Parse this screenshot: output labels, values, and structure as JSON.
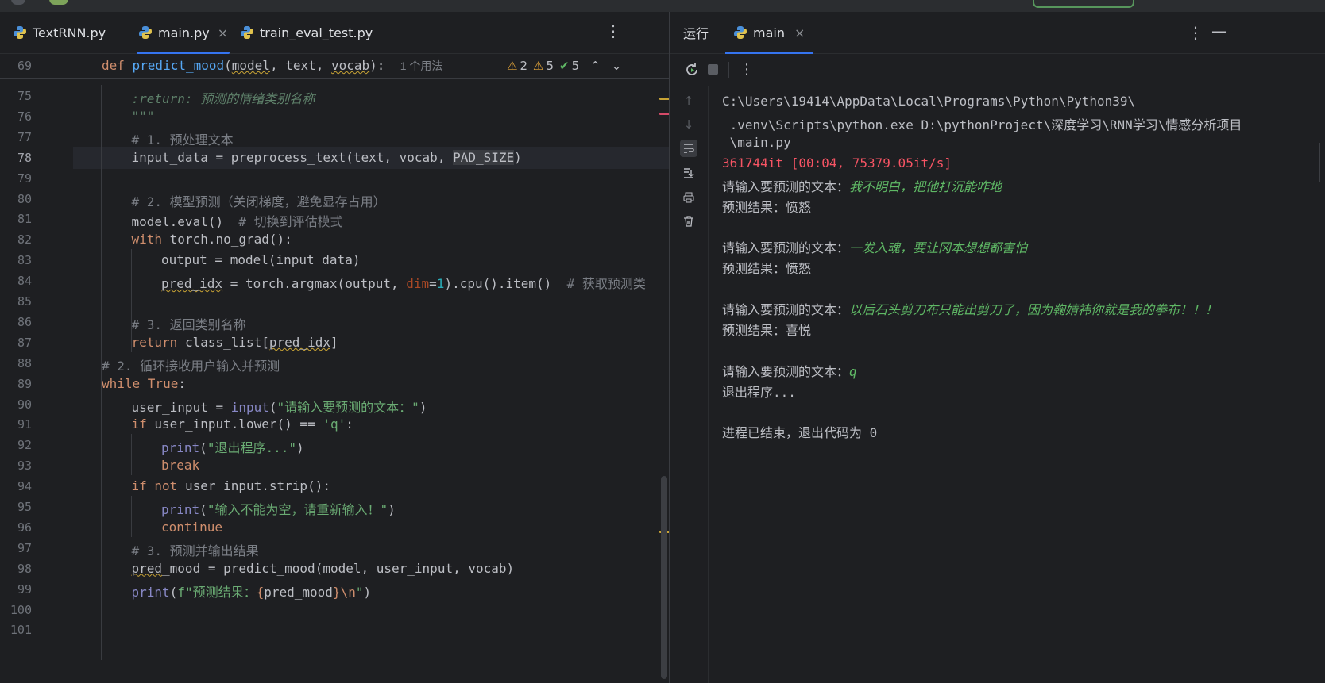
{
  "editor": {
    "tabs": [
      {
        "label": "TextRNN.py",
        "active": false,
        "closable": false
      },
      {
        "label": "main.py",
        "active": true,
        "closable": true
      },
      {
        "label": "train_eval_test.py",
        "active": false,
        "closable": false
      }
    ],
    "sticky": {
      "line_number": "69",
      "tokens": [
        {
          "t": "def ",
          "c": "k"
        },
        {
          "t": "predict_mood",
          "c": "fn"
        },
        {
          "t": "("
        },
        {
          "t": "model",
          "c": "ul"
        },
        {
          "t": ", text, "
        },
        {
          "t": "vocab",
          "c": "ul"
        },
        {
          "t": "):  "
        }
      ],
      "usage_hint": "1 个用法"
    },
    "inspections": {
      "errors": "2",
      "warnings": "5",
      "ok": "5"
    },
    "lines": [
      {
        "n": "75",
        "indent": 2,
        "tokens": [
          {
            "t": ":return:",
            "c": "doci"
          },
          {
            "t": " 预测的情绪类别名称",
            "c": "doci"
          }
        ]
      },
      {
        "n": "76",
        "indent": 2,
        "tokens": [
          {
            "t": "\"\"\"",
            "c": "doc"
          }
        ]
      },
      {
        "n": "77",
        "indent": 2,
        "tokens": [
          {
            "t": "# 1. 预处理文本",
            "c": "cm"
          }
        ]
      },
      {
        "n": "78",
        "indent": 2,
        "current": true,
        "tokens": [
          {
            "t": "input_data = preprocess_text(text, vocab, "
          },
          {
            "t": "PAD_SIZE",
            "c": "pad"
          },
          {
            "t": ")"
          }
        ]
      },
      {
        "n": "79",
        "indent": 0,
        "tokens": []
      },
      {
        "n": "80",
        "indent": 2,
        "tokens": [
          {
            "t": "# 2. 模型预测（关闭梯度，避免显存占用）",
            "c": "cm"
          }
        ]
      },
      {
        "n": "81",
        "indent": 2,
        "tokens": [
          {
            "t": "model.eval()  "
          },
          {
            "t": "# 切换到评估模式",
            "c": "cm"
          }
        ]
      },
      {
        "n": "82",
        "indent": 2,
        "tokens": [
          {
            "t": "with ",
            "c": "k"
          },
          {
            "t": "torch.no_grad():"
          }
        ]
      },
      {
        "n": "83",
        "indent": 3,
        "tokens": [
          {
            "t": "output = model(input_data)"
          }
        ]
      },
      {
        "n": "84",
        "indent": 3,
        "tokens": [
          {
            "t": "pred_idx",
            "c": "ul"
          },
          {
            "t": " = torch.argmax(output, "
          },
          {
            "t": "dim",
            "c": "pr"
          },
          {
            "t": "="
          },
          {
            "t": "1",
            "c": "nm"
          },
          {
            "t": ").cpu().item()  "
          },
          {
            "t": "# 获取预测类",
            "c": "cm"
          }
        ]
      },
      {
        "n": "85",
        "indent": 0,
        "tokens": []
      },
      {
        "n": "86",
        "indent": 2,
        "tokens": [
          {
            "t": "# 3. 返回类别名称",
            "c": "cm"
          }
        ]
      },
      {
        "n": "87",
        "indent": 2,
        "tokens": [
          {
            "t": "return ",
            "c": "k"
          },
          {
            "t": "class_list["
          },
          {
            "t": "pred_idx",
            "c": "ul"
          },
          {
            "t": "]"
          }
        ]
      },
      {
        "n": "88",
        "indent": 1,
        "tokens": [
          {
            "t": "# 2. 循环接收用户输入并预测",
            "c": "cm"
          }
        ]
      },
      {
        "n": "89",
        "indent": 1,
        "tokens": [
          {
            "t": "while ",
            "c": "k"
          },
          {
            "t": "True",
            "c": "k"
          },
          {
            "t": ":"
          }
        ]
      },
      {
        "n": "90",
        "indent": 2,
        "tokens": [
          {
            "t": "user_input = "
          },
          {
            "t": "input",
            "c": "bi"
          },
          {
            "t": "("
          },
          {
            "t": "\"请输入要预测的文本：\"",
            "c": "st"
          },
          {
            "t": ")"
          }
        ]
      },
      {
        "n": "91",
        "indent": 2,
        "tokens": [
          {
            "t": "if ",
            "c": "k"
          },
          {
            "t": "user_input.lower() == "
          },
          {
            "t": "'q'",
            "c": "st"
          },
          {
            "t": ":"
          }
        ]
      },
      {
        "n": "92",
        "indent": 3,
        "tokens": [
          {
            "t": "print",
            "c": "bi"
          },
          {
            "t": "("
          },
          {
            "t": "\"退出程序...\"",
            "c": "st"
          },
          {
            "t": ")"
          }
        ]
      },
      {
        "n": "93",
        "indent": 3,
        "tokens": [
          {
            "t": "break",
            "c": "k"
          }
        ]
      },
      {
        "n": "94",
        "indent": 2,
        "tokens": [
          {
            "t": "if not ",
            "c": "k"
          },
          {
            "t": "user_input.strip():"
          }
        ]
      },
      {
        "n": "95",
        "indent": 3,
        "tokens": [
          {
            "t": "print",
            "c": "bi"
          },
          {
            "t": "("
          },
          {
            "t": "\"输入不能为空，请重新输入！\"",
            "c": "st"
          },
          {
            "t": ")"
          }
        ]
      },
      {
        "n": "96",
        "indent": 3,
        "tokens": [
          {
            "t": "continue",
            "c": "k"
          }
        ]
      },
      {
        "n": "97",
        "indent": 2,
        "tokens": [
          {
            "t": "# 3. 预测并输出结果",
            "c": "cm"
          }
        ]
      },
      {
        "n": "98",
        "indent": 2,
        "tokens": [
          {
            "t": "pred",
            "c": "ul"
          },
          {
            "t": "_mood = predict_mood(model, user_input, vocab)"
          }
        ]
      },
      {
        "n": "99",
        "indent": 2,
        "tokens": [
          {
            "t": "print",
            "c": "bi"
          },
          {
            "t": "("
          },
          {
            "t": "f\"预测结果：",
            "c": "st"
          },
          {
            "t": "{",
            "c": "k"
          },
          {
            "t": "pred_mood"
          },
          {
            "t": "}",
            "c": "k"
          },
          {
            "t": "\\n",
            "c": "k"
          },
          {
            "t": "\"",
            "c": "st"
          },
          {
            "t": ")"
          }
        ]
      },
      {
        "n": "100",
        "indent": 0,
        "tokens": []
      },
      {
        "n": "101",
        "indent": 0,
        "tokens": []
      }
    ]
  },
  "run": {
    "label": "运行",
    "tab": "main",
    "console": [
      {
        "parts": [
          {
            "t": "C:\\Users\\19414\\AppData\\Local\\Programs\\Python\\Python39\\"
          }
        ]
      },
      {
        "parts": [
          {
            "t": " .venv\\Scripts\\python.exe D:\\pythonProject\\深度学习\\RNN学习\\情感分析项目"
          }
        ]
      },
      {
        "parts": [
          {
            "t": " \\main.py"
          }
        ]
      },
      {
        "parts": [
          {
            "t": "361744it [00:04, 75379.05it/s]",
            "c": "cerr"
          }
        ]
      },
      {
        "parts": [
          {
            "t": "请输入要预测的文本："
          },
          {
            "t": "我不明白，把他打沉能咋地",
            "c": "cin"
          }
        ]
      },
      {
        "parts": [
          {
            "t": "预测结果：愤怒"
          }
        ]
      },
      {
        "parts": []
      },
      {
        "parts": [
          {
            "t": "请输入要预测的文本："
          },
          {
            "t": "一发入魂，要让冈本想想都害怕",
            "c": "cin"
          }
        ]
      },
      {
        "parts": [
          {
            "t": "预测结果：愤怒"
          }
        ]
      },
      {
        "parts": []
      },
      {
        "parts": [
          {
            "t": "请输入要预测的文本："
          },
          {
            "t": "以后石头剪刀布只能出剪刀了，因为鞠婧祎你就是我的拳布！！！",
            "c": "cin"
          }
        ]
      },
      {
        "parts": [
          {
            "t": "预测结果：喜悦"
          }
        ]
      },
      {
        "parts": []
      },
      {
        "parts": [
          {
            "t": "请输入要预测的文本："
          },
          {
            "t": "q",
            "c": "cin"
          }
        ]
      },
      {
        "parts": [
          {
            "t": "退出程序..."
          }
        ]
      },
      {
        "parts": []
      },
      {
        "parts": [
          {
            "t": "进程已结束，退出代码为 0"
          }
        ]
      }
    ]
  },
  "colors": {
    "accent": "#3574f0",
    "keyword": "#cf8e6d",
    "string": "#6aab73",
    "comment": "#7a7e85",
    "function": "#56a8f5",
    "error": "#f75464"
  }
}
